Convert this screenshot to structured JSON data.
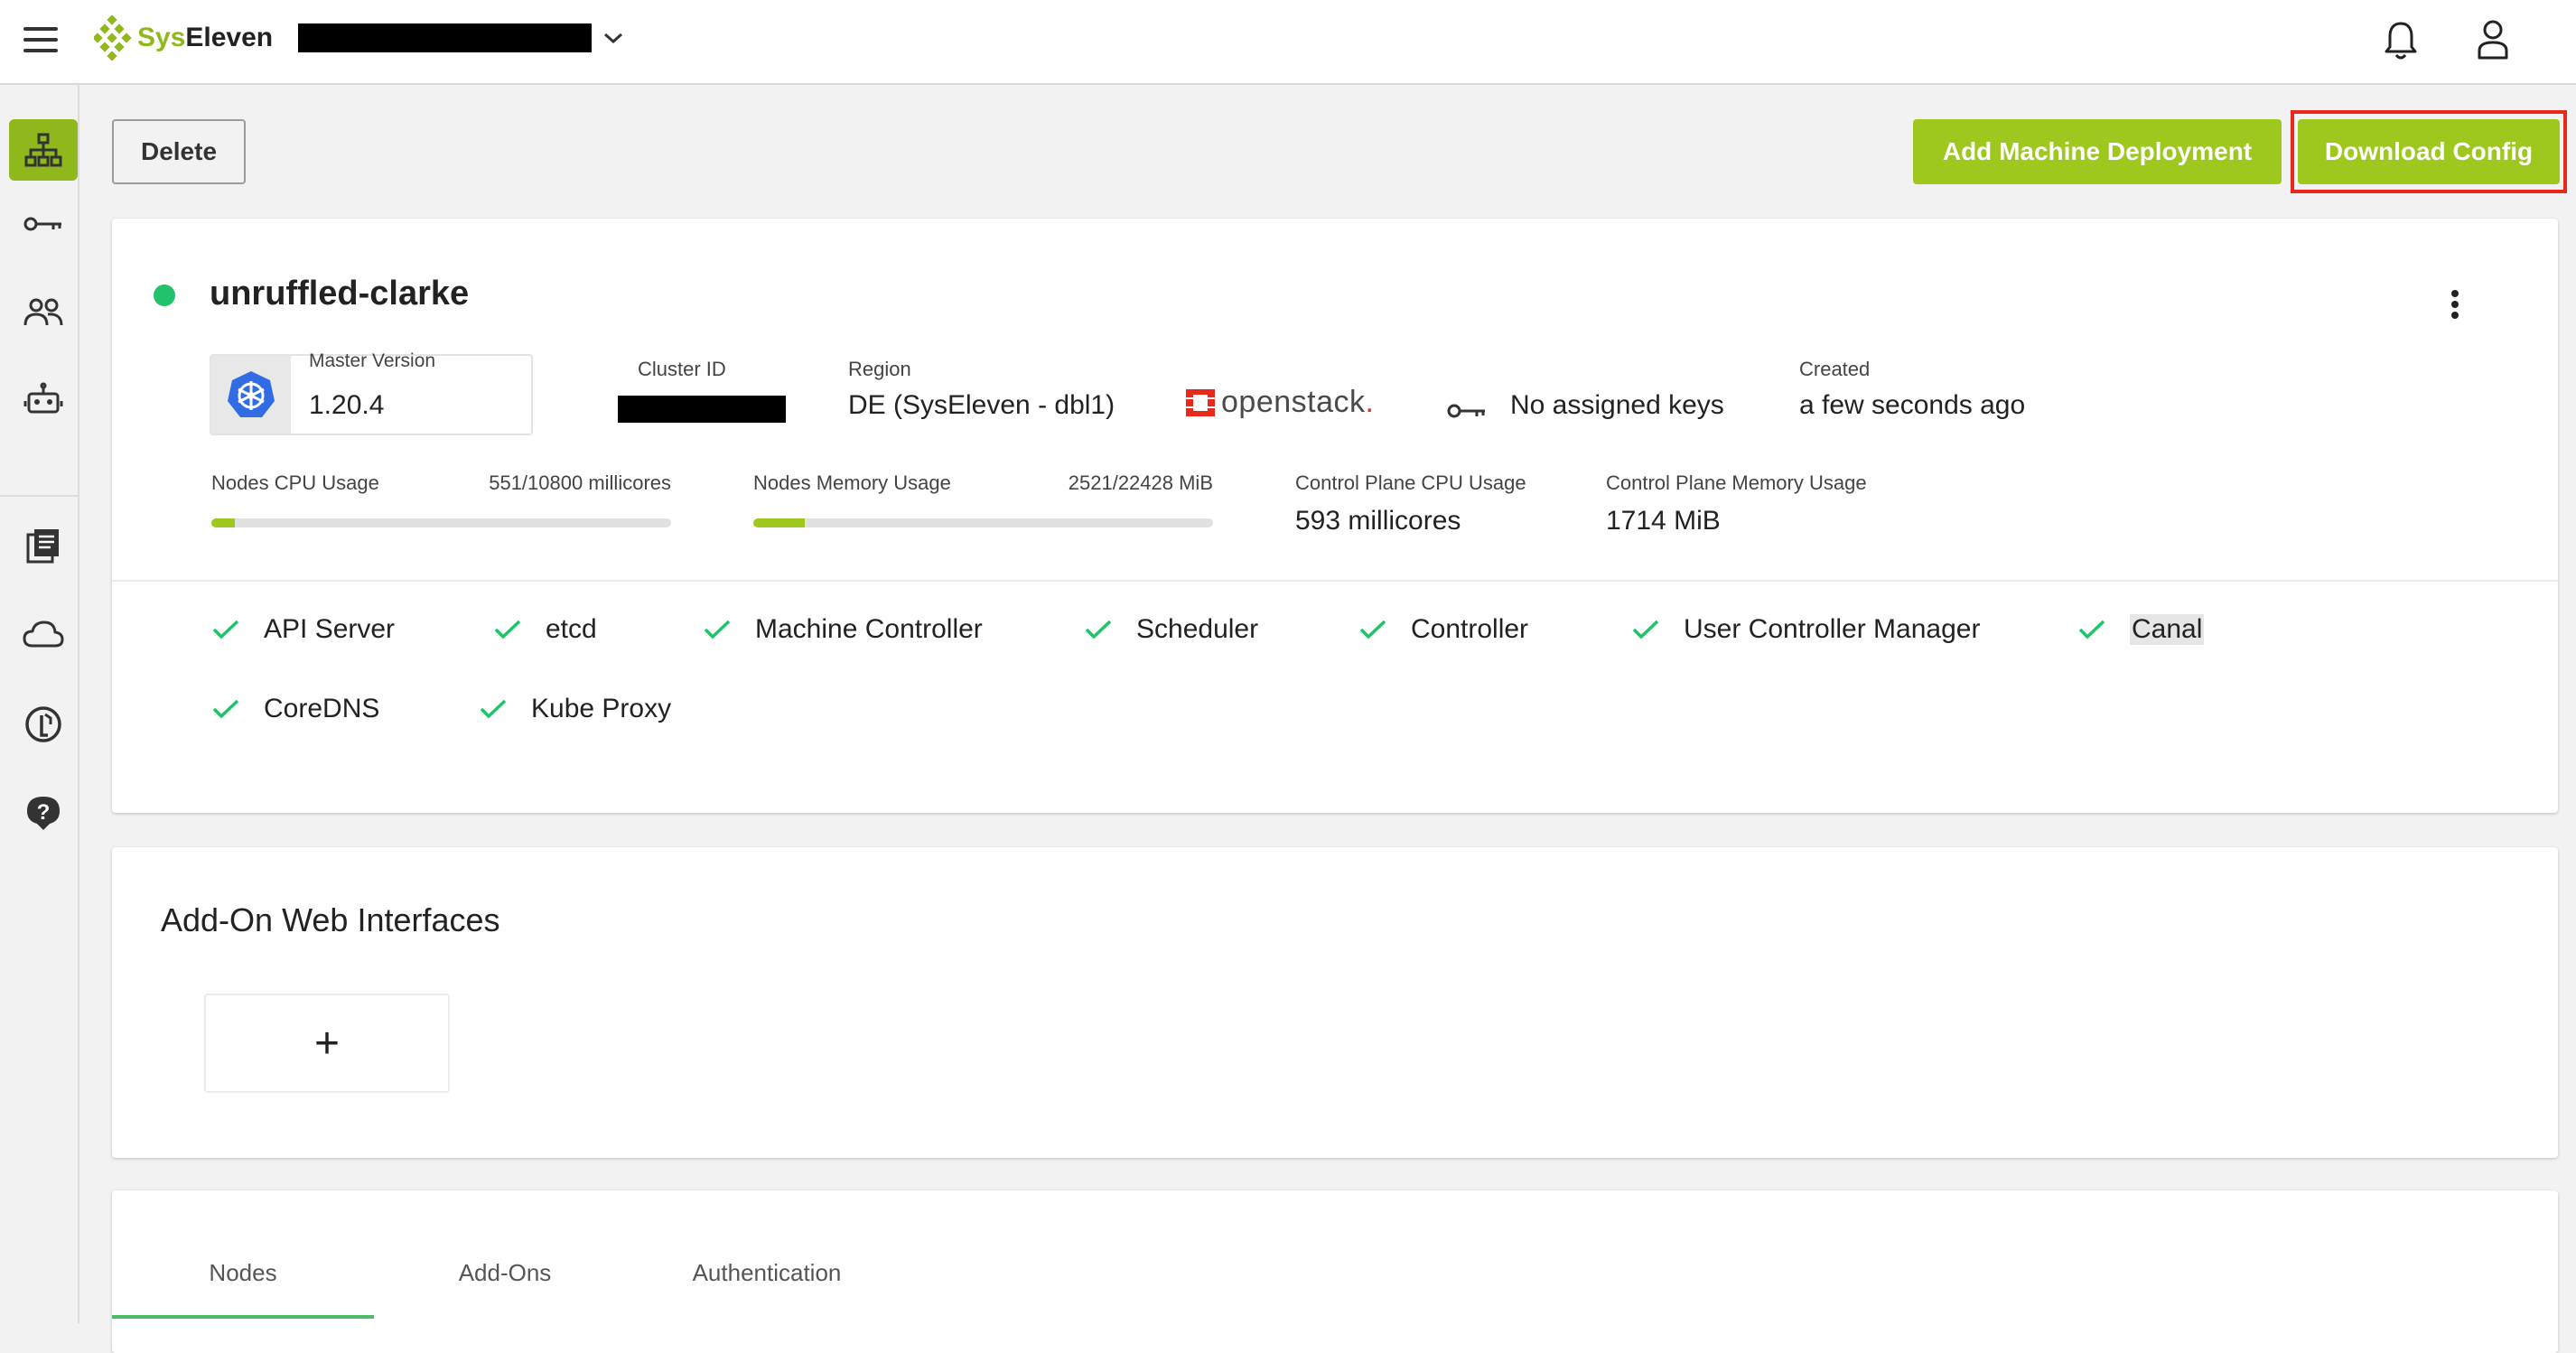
{
  "app": {
    "brand_sys": "Sys",
    "brand_eleven": "Eleven",
    "project_name": ""
  },
  "icons": {
    "menu": "hamburger-menu-icon",
    "notifications": "bell-icon",
    "account": "user-icon",
    "nav": [
      "cluster-hierarchy-icon",
      "key-icon",
      "members-icon",
      "robot-icon",
      "docs-icon",
      "cloud-icon",
      "info-icon",
      "help-icon"
    ]
  },
  "actions": {
    "delete_label": "Delete",
    "add_md_label": "Add Machine Deployment",
    "download_label": "Download Config"
  },
  "cluster": {
    "name": "unruffled-clarke",
    "status_color": "#21c36a",
    "master_version_label": "Master Version",
    "master_version": "1.20.4",
    "cluster_id_label": "Cluster ID",
    "cluster_id": "",
    "region_label": "Region",
    "region": "DE (SysEleven - dbl1)",
    "provider": "openstack",
    "provider_suffix": ".",
    "ssh_keys": "No assigned keys",
    "created_label": "Created",
    "created": "a few seconds ago"
  },
  "usage": {
    "nodes_cpu_label": "Nodes CPU Usage",
    "nodes_cpu_value": "551/10800 millicores",
    "nodes_cpu_fraction": 0.051,
    "nodes_mem_label": "Nodes Memory Usage",
    "nodes_mem_value": "2521/22428 MiB",
    "nodes_mem_fraction": 0.112,
    "cp_cpu_label": "Control Plane CPU Usage",
    "cp_cpu_value": "593 millicores",
    "cp_mem_label": "Control Plane Memory Usage",
    "cp_mem_value": "1714 MiB"
  },
  "health": [
    {
      "label": "API Server"
    },
    {
      "label": "etcd"
    },
    {
      "label": "Machine Controller"
    },
    {
      "label": "Scheduler"
    },
    {
      "label": "Controller"
    },
    {
      "label": "User Controller Manager"
    },
    {
      "label": "Canal"
    },
    {
      "label": "CoreDNS"
    },
    {
      "label": "Kube Proxy"
    }
  ],
  "addons": {
    "title": "Add-On Web Interfaces",
    "add_symbol": "+"
  },
  "tabs": [
    {
      "label": "Nodes"
    },
    {
      "label": "Add-Ons"
    },
    {
      "label": "Authentication"
    }
  ],
  "colors": {
    "accent": "#9ec81e",
    "status_ok": "#21c36a",
    "highlight": "#e8291c",
    "openstack": "#e8291c"
  }
}
